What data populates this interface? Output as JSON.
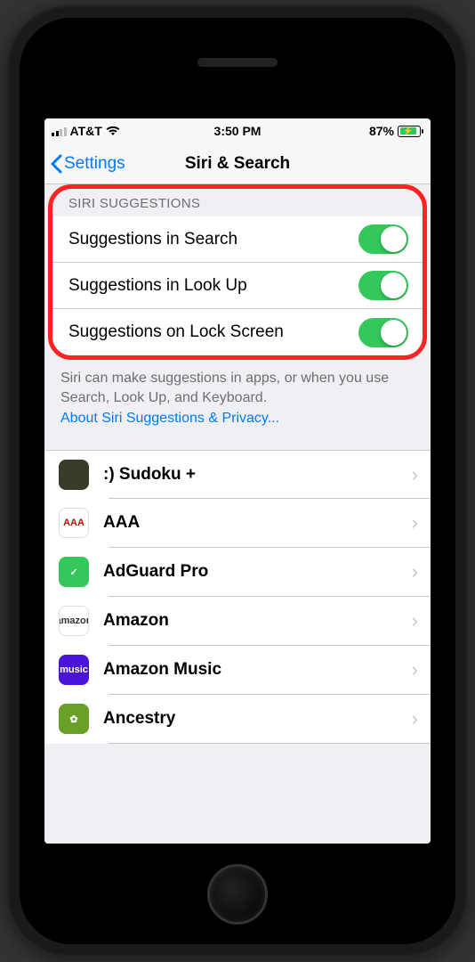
{
  "status": {
    "carrier": "AT&T",
    "time": "3:50 PM",
    "battery_pct": "87%"
  },
  "nav": {
    "back": "Settings",
    "title": "Siri & Search"
  },
  "section": {
    "header": "SIRI SUGGESTIONS",
    "rows": [
      {
        "label": "Suggestions in Search",
        "on": true
      },
      {
        "label": "Suggestions in Look Up",
        "on": true
      },
      {
        "label": "Suggestions on Lock Screen",
        "on": true
      }
    ],
    "footer_text": "Siri can make suggestions in apps, or when you use Search, Look Up, and Keyboard.",
    "footer_link": "About Siri Suggestions & Privacy..."
  },
  "apps": [
    {
      "name": ":) Sudoku +",
      "icon_bg": "#3a3a2a",
      "icon_text": ""
    },
    {
      "name": "AAA",
      "icon_bg": "#ffffff",
      "icon_text": "AAA",
      "icon_color": "#cc0000"
    },
    {
      "name": "AdGuard Pro",
      "icon_bg": "#34c759",
      "icon_text": "✓"
    },
    {
      "name": "Amazon",
      "icon_bg": "#ffffff",
      "icon_text": "amazon",
      "icon_color": "#333"
    },
    {
      "name": "Amazon Music",
      "icon_bg": "#4b12d8",
      "icon_text": "music"
    },
    {
      "name": "Ancestry",
      "icon_bg": "#6aa028",
      "icon_text": "✿"
    }
  ]
}
